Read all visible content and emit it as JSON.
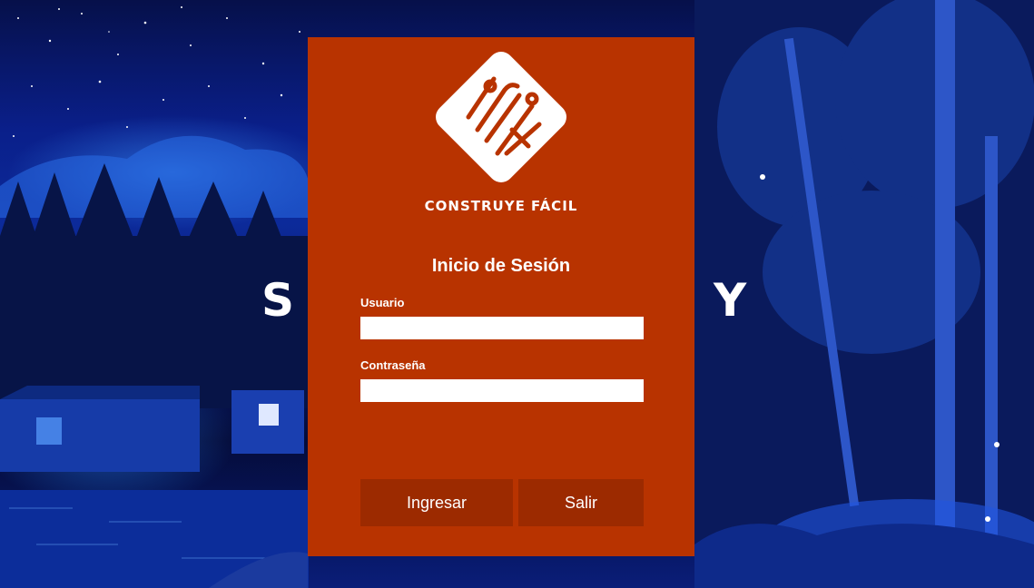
{
  "background": {
    "left_fragment": "S",
    "right_fragment": "Y"
  },
  "brand": {
    "name": "CONSTRUYE FÁCIL"
  },
  "login": {
    "title": "Inicio de Sesión",
    "username_label": "Usuario",
    "username_value": "",
    "password_label": "Contraseña",
    "password_value": "",
    "login_button": "Ingresar",
    "exit_button": "Salir"
  },
  "colors": {
    "panel": "#b83300",
    "button": "#9c2a00",
    "text": "#ffffff"
  },
  "icons": {
    "logo": "tools-logo-icon"
  }
}
